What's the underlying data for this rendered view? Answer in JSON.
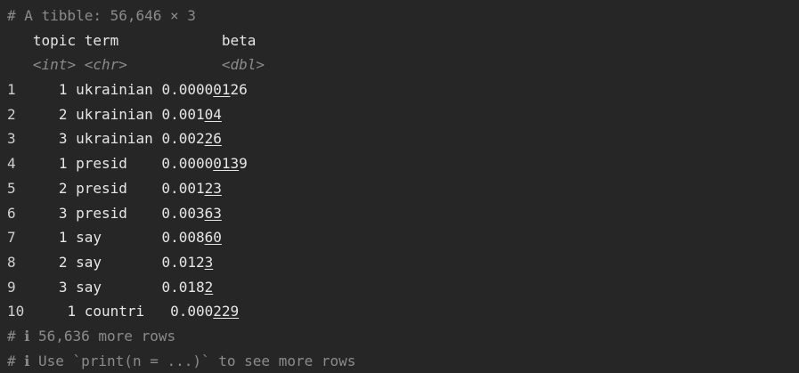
{
  "header": {
    "comment": "# A tibble: 56,646 × 3"
  },
  "columns": {
    "names": [
      "topic",
      "term",
      "beta"
    ],
    "types": [
      "<int>",
      "<chr>",
      "<dbl>"
    ]
  },
  "rows": [
    {
      "n": "1",
      "topic": "1",
      "term": "ukrainian",
      "beta_plain": "0.0000",
      "beta_under": "01",
      "beta_tail": "26"
    },
    {
      "n": "2",
      "topic": "2",
      "term": "ukrainian",
      "beta_plain": "0.001",
      "beta_under": "04",
      "beta_tail": ""
    },
    {
      "n": "3",
      "topic": "3",
      "term": "ukrainian",
      "beta_plain": "0.002",
      "beta_under": "26",
      "beta_tail": ""
    },
    {
      "n": "4",
      "topic": "1",
      "term": "presid",
      "beta_plain": "0.0000",
      "beta_under": "013",
      "beta_tail": "9"
    },
    {
      "n": "5",
      "topic": "2",
      "term": "presid",
      "beta_plain": "0.001",
      "beta_under": "23",
      "beta_tail": ""
    },
    {
      "n": "6",
      "topic": "3",
      "term": "presid",
      "beta_plain": "0.003",
      "beta_under": "63",
      "beta_tail": ""
    },
    {
      "n": "7",
      "topic": "1",
      "term": "say",
      "beta_plain": "0.008",
      "beta_under": "60",
      "beta_tail": ""
    },
    {
      "n": "8",
      "topic": "2",
      "term": "say",
      "beta_plain": "0.012",
      "beta_under": "3",
      "beta_tail": ""
    },
    {
      "n": "9",
      "topic": "3",
      "term": "say",
      "beta_plain": "0.018",
      "beta_under": "2",
      "beta_tail": ""
    },
    {
      "n": "10",
      "topic": "1",
      "term": "countri",
      "beta_plain": "0.000",
      "beta_under": "229",
      "beta_tail": ""
    }
  ],
  "footer": {
    "more_rows": "# ℹ 56,636 more rows",
    "hint": "# ℹ Use `print(n = ...)` to see more rows"
  },
  "colors": {
    "background": "#262626",
    "text": "#e6e6e6",
    "comment": "#8b8b8b"
  }
}
